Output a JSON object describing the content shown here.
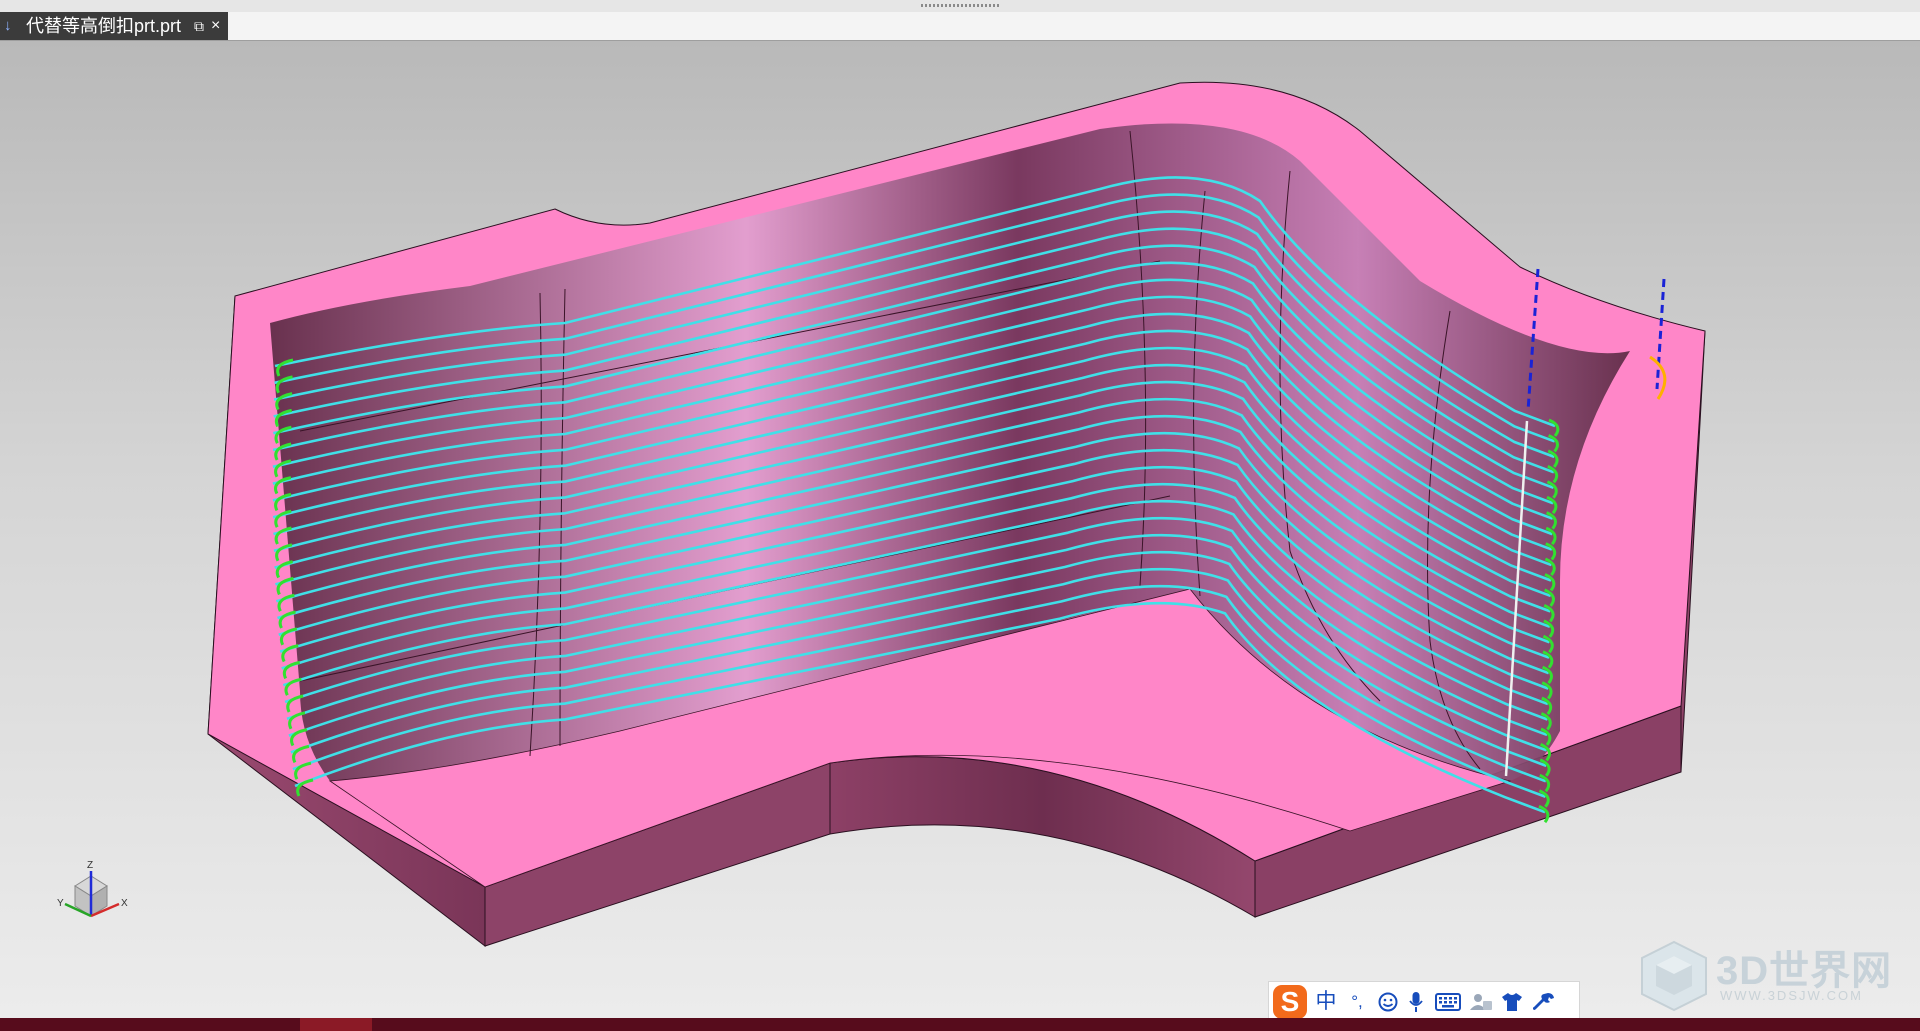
{
  "window": {
    "tab_title": "代替等高倒扣prt.prt",
    "tab_icon": "down-arrow-icon",
    "popout_icon": "popout-icon",
    "close_icon": "close-icon"
  },
  "triad": {
    "x": "X",
    "y": "Y",
    "z": "Z"
  },
  "ime": {
    "logo": "S",
    "lang": "中",
    "punct": "°,",
    "icons": [
      "smiley-icon",
      "microphone-icon",
      "keyboard-icon",
      "user-card-icon",
      "skin-shirt-icon",
      "wrench-icon"
    ]
  },
  "watermark": {
    "text": "3D世界网",
    "sub": "WWW.3DSJW.COM"
  },
  "colors": {
    "part_top": "#ff86c8",
    "part_side": "#8f4468",
    "toolpath": "#40e0e8",
    "engage": "#32e030",
    "tool_axis": "#1a23d6",
    "feed": "#ffd000"
  }
}
